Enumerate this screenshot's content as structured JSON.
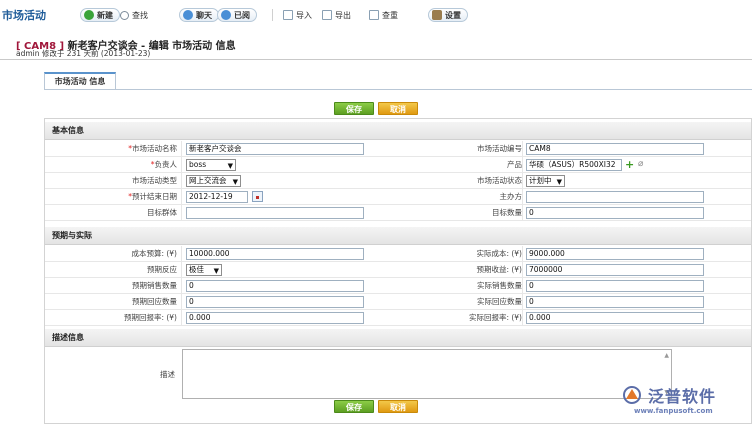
{
  "app": {
    "module_title": "市场活动"
  },
  "toolbar": {
    "new": "新建",
    "find": "查找",
    "chat": "聊天",
    "read": "已阅",
    "import": "导入",
    "export": "导出",
    "view": "查重",
    "settings": "设置"
  },
  "record": {
    "code": "[ CAM8 ]",
    "title": "新老客户交谈会 - 编辑 市场活动 信息",
    "subtitle": "admin 修改于 231 天前 (2013-01-23)"
  },
  "tabs": [
    "市场活动 信息"
  ],
  "buttons": {
    "save": "保存",
    "cancel": "取消"
  },
  "sections": {
    "basic": "基本信息",
    "expect": "预期与实际",
    "desc": "描述信息"
  },
  "basic_rows": [
    {
      "l_label": "*市场活动名称",
      "l_value": "新老客户交谈会",
      "r_label": "市场活动编号",
      "r_value": "CAM8"
    },
    {
      "l_label": "*负责人",
      "l_value": "boss",
      "r_label": "产品",
      "r_value": "华硕（ASUS）R500XI32"
    },
    {
      "l_label": "市场活动类型",
      "l_value": "网上交流会",
      "r_label": "市场活动状态",
      "r_value": "计划中"
    },
    {
      "l_label": "*预计结束日期",
      "l_value": "2012-12-19",
      "r_label": "主办方",
      "r_value": ""
    },
    {
      "l_label": "目标群体",
      "l_value": "",
      "r_label": "目标数量",
      "r_value": "0"
    }
  ],
  "expect_rows": [
    {
      "l_label": "成本预算: (¥)",
      "l_value": "10000.000",
      "r_label": "实际成本: (¥)",
      "r_value": "9000.000"
    },
    {
      "l_label": "预期反应",
      "l_value": "极佳",
      "r_label": "预期收益: (¥)",
      "r_value": "7000000"
    },
    {
      "l_label": "预期销售数量",
      "l_value": "0",
      "r_label": "实际销售数量",
      "r_value": "0"
    },
    {
      "l_label": "预期回应数量",
      "l_value": "0",
      "r_label": "实际回应数量",
      "r_value": "0"
    },
    {
      "l_label": "预期回报率: (¥)",
      "l_value": "0.000",
      "r_label": "实际回报率: (¥)",
      "r_value": "0.000"
    }
  ],
  "desc_label": "描述",
  "desc_value": "",
  "logo": {
    "name": "泛普软件",
    "url": "www.fanpusoft.com"
  }
}
